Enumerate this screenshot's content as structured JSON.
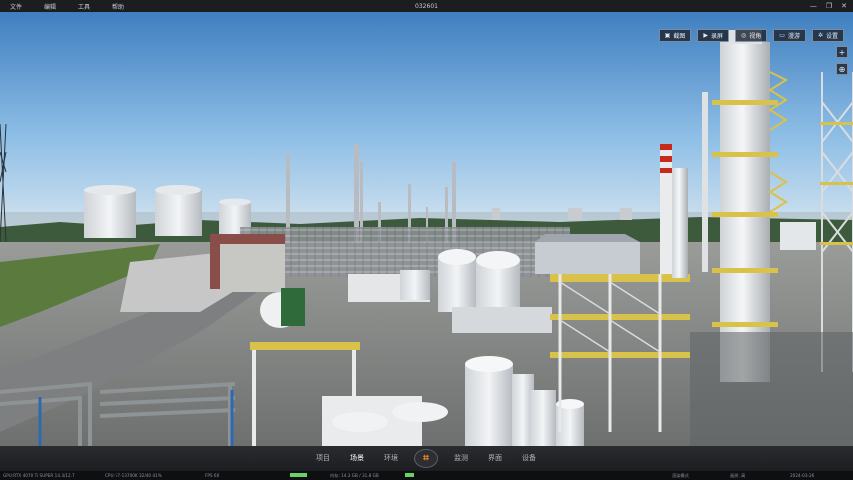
{
  "app": {
    "title": "032601",
    "menu": [
      "文件",
      "编辑",
      "工具",
      "帮助"
    ],
    "window_controls": [
      "—",
      "❐",
      "✕"
    ]
  },
  "toolbar": [
    {
      "icon": "image-icon",
      "glyph": "▣",
      "label": "截图"
    },
    {
      "icon": "video-icon",
      "glyph": "▶",
      "label": "录屏"
    },
    {
      "icon": "view-icon",
      "glyph": "◎",
      "label": "视角"
    },
    {
      "icon": "monitor-icon",
      "glyph": "▭",
      "label": "漫游"
    },
    {
      "icon": "settings-icon",
      "glyph": "✲",
      "label": "设置"
    }
  ],
  "side_controls": [
    {
      "icon": "plus-icon",
      "glyph": "+"
    },
    {
      "icon": "compass-icon",
      "glyph": "⊕"
    }
  ],
  "bottom_nav": {
    "left": [
      "项目",
      "场景",
      "环境"
    ],
    "right": [
      "监测",
      "界面",
      "设备"
    ],
    "active": "场景",
    "center_glyph": "⌗"
  },
  "status_bar": {
    "items": [
      "GPU:RTX  4070 Ti  SUPER 14.3/12.7",
      "CPU: i7-13700K  32/40  41%",
      "FPS 60",
      "内存: 14.3 GB / 31.8 GB",
      "渲染模式",
      "画质: 高",
      "2024-03-26"
    ],
    "progress": [
      0.55,
      0.3
    ]
  },
  "colors": {
    "accent": "#f08a18",
    "sky_top": "#3f7fc0",
    "sky_horizon": "#dce8f0",
    "stair_yellow": "#d9c24a"
  }
}
